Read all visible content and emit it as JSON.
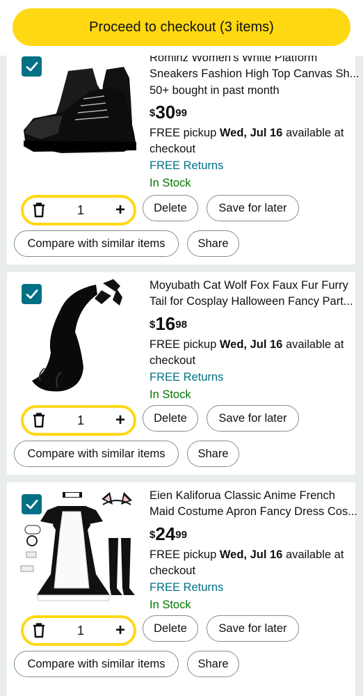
{
  "checkout": {
    "label": "Proceed to checkout (3 items)"
  },
  "items": [
    {
      "title_line1": "Rominz Women's White Platform",
      "title_line2": "Sneakers Fashion High Top Canvas Sh...",
      "bought": "50+ bought in past month",
      "price_symbol": "$",
      "price_dollars": "30",
      "price_cents": "99",
      "pickup_prefix": "FREE pickup ",
      "pickup_date": "Wed, Jul 16",
      "pickup_suffix": " available at checkout",
      "returns": "FREE Returns",
      "stock": "In Stock",
      "quantity": "1",
      "delete": "Delete",
      "save": "Save for later",
      "compare": "Compare with similar items",
      "share": "Share"
    },
    {
      "title_line1": "Moyubath Cat Wolf Fox Faux Fur Furry",
      "title_line2": "Tail for Cosplay Halloween Fancy Part...",
      "price_symbol": "$",
      "price_dollars": "16",
      "price_cents": "98",
      "pickup_prefix": "FREE pickup ",
      "pickup_date": "Wed, Jul 16",
      "pickup_suffix": " available at checkout",
      "returns": "FREE Returns",
      "stock": "In Stock",
      "quantity": "1",
      "delete": "Delete",
      "save": "Save for later",
      "compare": "Compare with similar items",
      "share": "Share"
    },
    {
      "title_line1": "Eien Kaliforua Classic Anime French",
      "title_line2": "Maid Costume Apron Fancy Dress Cos...",
      "price_symbol": "$",
      "price_dollars": "24",
      "price_cents": "99",
      "pickup_prefix": "FREE pickup ",
      "pickup_date": "Wed, Jul 16",
      "pickup_suffix": " available at checkout",
      "returns": "FREE Returns",
      "stock": "In Stock",
      "quantity": "1",
      "delete": "Delete",
      "save": "Save for later",
      "compare": "Compare with similar items",
      "share": "Share"
    }
  ],
  "icons": {
    "checkbox": "checkmark-icon",
    "trash": "trash-icon",
    "plus": "plus-icon"
  },
  "colors": {
    "accent_yellow": "#ffd814",
    "link_teal": "#007185",
    "stock_green": "#007600",
    "checkbox_teal": "#007185"
  }
}
